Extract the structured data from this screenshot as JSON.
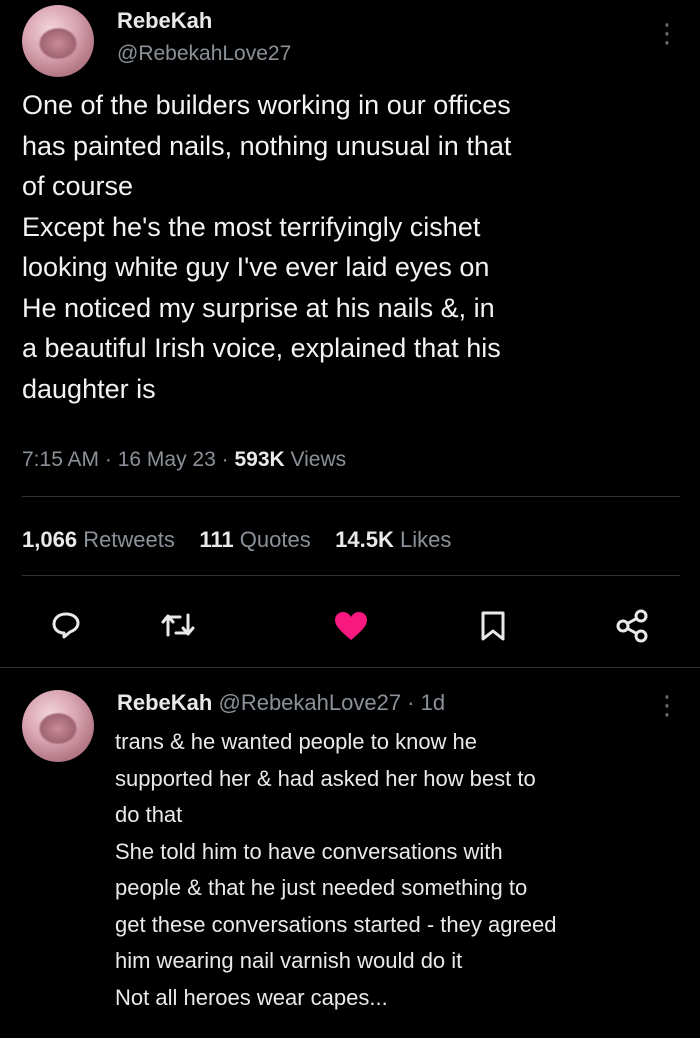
{
  "tweet": {
    "display_name": "RebeKah",
    "handle": "@RebekahLove27",
    "text": "One of the builders working in our offices\nhas painted nails, nothing unusual in that\nof course\nExcept he's the most terrifyingly cishet\nlooking white guy I've ever laid eyes on\nHe noticed my surprise at his nails &, in\na beautiful Irish voice, explained that his\ndaughter is",
    "time": "7:15 AM",
    "date": "16 May 23",
    "views_count": "593K",
    "views_label": "Views",
    "separator": " · ",
    "stats": {
      "retweets_count": "1,066",
      "retweets_label": "Retweets",
      "quotes_count": "111",
      "quotes_label": "Quotes",
      "likes_count": "14.5K",
      "likes_label": "Likes"
    },
    "actions": {
      "reply_icon": "reply-icon",
      "retweet_icon": "retweet-icon",
      "like_icon": "heart-icon",
      "bookmark_icon": "bookmark-icon",
      "share_icon": "share-icon"
    },
    "like_color": "#f91880"
  },
  "reply": {
    "display_name": "RebeKah",
    "handle": "@RebekahLove27",
    "age": "1d",
    "separator": " · ",
    "text": "trans & he wanted people to know he\nsupported her & had asked her how best to\ndo that\nShe told him to have conversations with\npeople & that he just needed something to\nget these conversations started - they agreed\nhim wearing nail varnish would do it\nNot all heroes wear capes..."
  },
  "menu_glyph": "⋮"
}
